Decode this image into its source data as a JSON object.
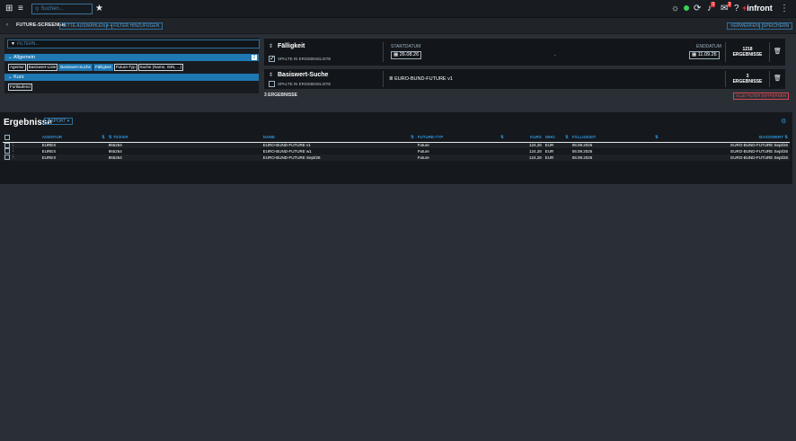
{
  "topbar": {
    "search_placeholder": "Suchen...",
    "badges": {
      "alerts": "3",
      "messages": "3"
    },
    "logo_plus": "+",
    "logo_text": "infront"
  },
  "subbar": {
    "page_title": "FUTURE-SCREENER",
    "select_label": "BITTE AUSWÄHLEN",
    "add_filter_label": "+ FILTER HINZUFÜGEN",
    "discard_label": "VERWERFEN",
    "save_label": "SPEICHERN"
  },
  "filter_panel": {
    "filter_placeholder": "FILTERN...",
    "groups": [
      {
        "label": "Allgemein",
        "count": "2",
        "tags": [
          {
            "label": "Agentur",
            "active": false
          },
          {
            "label": "Basiswert-Liste",
            "active": false
          },
          {
            "label": "Basiswert-Suche",
            "active": true
          },
          {
            "label": "Fälligkeit",
            "active": true
          },
          {
            "label": "Future-Typ",
            "active": false
          },
          {
            "label": "Suche (Name, ISIN, ...)",
            "active": false
          }
        ]
      },
      {
        "label": "Kurs",
        "tags": [
          {
            "label": "Fortlaufend",
            "active": false
          }
        ]
      }
    ]
  },
  "criteria": [
    {
      "title": "Fälligkeit",
      "show_col_label": "SPALTE IN ERGEBNISLISTE",
      "show_col_checked": true,
      "start_label": "STARTDATUM",
      "start_value": "26.08.26",
      "dash": "-",
      "end_label": "ENDDATUM",
      "end_value": "11.09.26",
      "result_count": "1218",
      "result_label": "ERGEBNISSE"
    },
    {
      "title": "Basiswert-Suche",
      "show_col_label": "SPALTE IN ERGEBNISLISTE",
      "show_col_checked": false,
      "value": "EURO-BUND-FUTURE v1",
      "result_count": "3",
      "result_label": "ERGEBNISSE"
    }
  ],
  "summary": {
    "count_label": "3 ERGEBNISSE",
    "remove_all_label": "ALLE FILTER ENTFERNEN"
  },
  "results": {
    "title": "Ergebnisse",
    "export_label": "EXPORT",
    "columns": [
      "AGENTUR",
      "TICKER",
      "NAME",
      "FUTURE-TYP",
      "KURS",
      "WHG",
      "FÄLLIGKEIT",
      "BASISWERT"
    ],
    "rows": [
      [
        "EUREX",
        "965264",
        "EURO-BUND-FUTURE v1",
        "Future",
        "124,28",
        "EUR",
        "08.09.2026",
        "EURO-BUND-FUTURE Sept/26"
      ],
      [
        "EUREX",
        "965264",
        "EURO-BUND-FUTURE w1",
        "Future",
        "124,28",
        "EUR",
        "08.09.2026",
        "EURO-BUND-FUTURE Sept/26"
      ],
      [
        "EUREX",
        "965264",
        "EURO-BUND-FUTURE Sept/26",
        "Future",
        "124,28",
        "EUR",
        "08.09.2026",
        "EURO-BUND-FUTURE Sept/26"
      ]
    ]
  },
  "colors": {
    "accent": "#1e78b2",
    "danger": "#e0353b",
    "status_green": "#39d353"
  }
}
